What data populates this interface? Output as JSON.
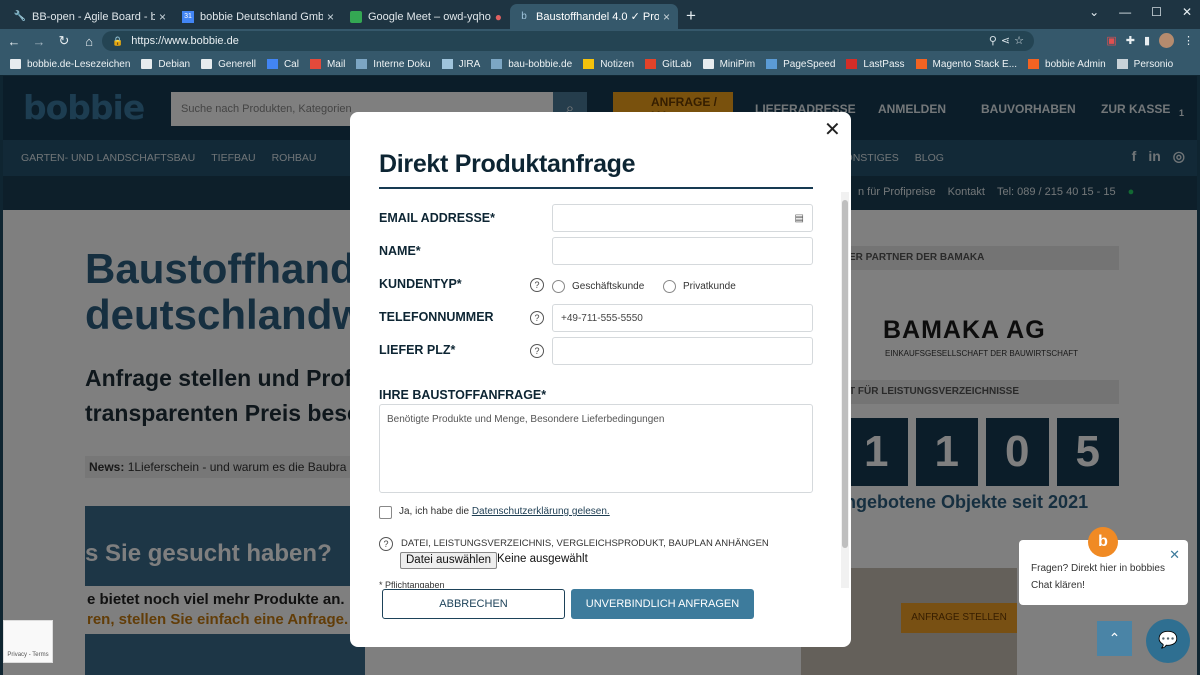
{
  "browser": {
    "tabs": [
      {
        "label": "BB-open - Agile Board - bobb",
        "icon": "wrench-icon"
      },
      {
        "label": "bobbie Deutschland GmbH -",
        "icon": "calendar-icon"
      },
      {
        "label": "Google Meet – owd-yqho",
        "icon": "meet-icon"
      },
      {
        "label": "Baustoffhandel 4.0 ✓ Profe",
        "icon": "bobbie-icon"
      }
    ],
    "new_tab": "+",
    "url": "https://www.bobbie.de",
    "bookmarks": [
      "bobbie.de-Lesezeichen",
      "Debian",
      "Generell",
      "Cal",
      "Mail",
      "Interne Doku",
      "JIRA",
      "bau-bobbie.de",
      "Notizen",
      "GitLab",
      "MiniPim",
      "PageSpeed",
      "LastPass",
      "Magento Stack E...",
      "bobbie Admin",
      "Personio"
    ]
  },
  "site": {
    "logo": "bobbie",
    "search_placeholder": "Suche nach Produkten, Kategorien",
    "header_buttons": [
      "ANFRAGE / LV",
      "LIEFERADRESSE",
      "ANMELDEN",
      "BAUVORHABEN",
      "ZUR KASSE"
    ],
    "cart_count": "1",
    "nav": [
      "GARTEN- UND LANDSCHAFTSBAU",
      "TIEFBAU",
      "ROHBAU",
      "SONSTIGES",
      "BLOG"
    ],
    "strip_links": [
      "n für Profipreise",
      "Kontakt",
      "Tel: 089 / 215 40 15 - 15"
    ],
    "hero_title_1": "Baustoffhande",
    "hero_title_2": "deutschlandw",
    "hero_sub_1": "Anfrage stellen und Profi-",
    "hero_sub_2": "transparenten Preis besc",
    "news_label": "News:",
    "news_text": "1Lieferschein - und warum es die Baubra",
    "banner_1": "s Sie gesucht haben?",
    "banner_2a": "e bietet noch viel mehr Produkte an.",
    "banner_2b": "ren, stellen Sie einfach eine Anfrage.",
    "partner_head": "ER PARTNER DER BAMAKA",
    "bamaka_logo": "BAMAKA AG",
    "bamaka_sub": "EINKAUFSGESELLSCHAFT DER BAUWIRTSCHAFT",
    "lv_head": "T FÜR LEISTUNGSVERZEICHNISSE",
    "counter_digits": [
      "1",
      "1",
      "0",
      "5"
    ],
    "counter_text": "ngebotene Objekte seit 2021",
    "anfrage_btn": "ANFRAGE STELLEN"
  },
  "modal": {
    "title": "Direkt Produktanfrage",
    "close": "✕",
    "labels": {
      "email": "EMAIL ADDRESSE*",
      "name": "NAME*",
      "kundentyp": "KUNDENTYP*",
      "telefon": "TELEFONNUMMER",
      "plz": "LIEFER PLZ*",
      "anfrage": "IHRE BAUSTOFFANFRAGE*"
    },
    "radio_business": "Geschäftskunde",
    "radio_private": "Privatkunde",
    "phone_placeholder": "+49-711-555-5550",
    "textarea_placeholder": "Benötigte Produkte und Menge, Besondere Lieferbedingungen",
    "privacy_prefix": "Ja, ich habe die ",
    "privacy_link": "Datenschutzerklärung gelesen.",
    "attach_label": "DATEI, LEISTUNGSVERZEICHNIS, VERGLEICHSPRODUKT, BAUPLAN ANHÄNGEN",
    "file_button": "Datei auswählen",
    "file_none": "Keine ausgewählt",
    "required_note": "* Pflichtangaben",
    "cancel": "ABBRECHEN",
    "submit": "UNVERBINDLICH ANFRAGEN"
  },
  "chat": {
    "bubble_text": "Fragen? Direkt hier in bobbies Chat klären!",
    "recaptcha": "Privacy - Terms"
  }
}
